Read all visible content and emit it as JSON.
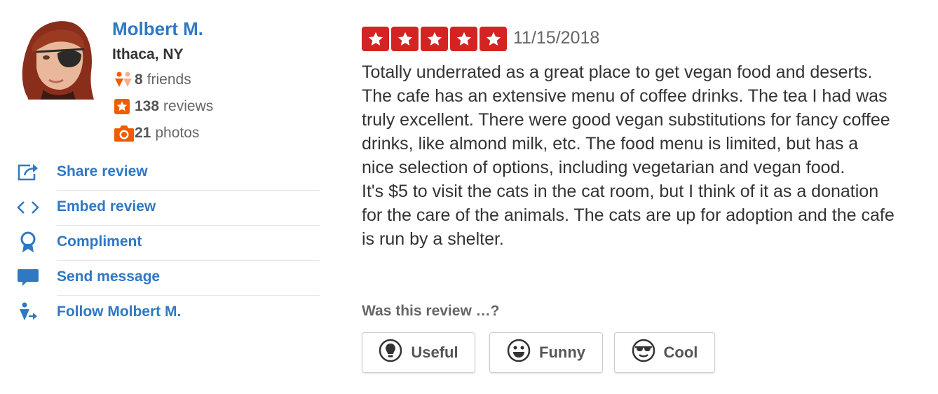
{
  "user": {
    "name": "Molbert M.",
    "location": "Ithaca, NY",
    "friends_count": "8",
    "friends_label": "friends",
    "reviews_count": "138",
    "reviews_label": "reviews",
    "photos_count": "21",
    "photos_label": "photos"
  },
  "actions": {
    "share": "Share review",
    "embed": "Embed review",
    "compliment": "Compliment",
    "message": "Send message",
    "follow": "Follow Molbert M."
  },
  "review": {
    "rating": 5,
    "rating_max": 5,
    "date": "11/15/2018",
    "text": "Totally underrated as a great place to get vegan food and deserts. The cafe has an extensive menu of coffee drinks. The tea I had was truly excellent. There were good vegan substitutions for fancy coffee drinks, like almond milk, etc. The food menu is limited, but has a nice selection of options, including vegetarian and vegan food.\nIt's $5 to visit the cats in the cat room, but I think of it as a donation for the care of the animals. The cats are up for adoption and the cafe is run by a shelter."
  },
  "votes": {
    "prompt": "Was this review …?",
    "useful": "Useful",
    "funny": "Funny",
    "cool": "Cool"
  },
  "colors": {
    "link": "#2f78c4",
    "star_red": "#d32323",
    "stat_orange": "#f15c00"
  }
}
